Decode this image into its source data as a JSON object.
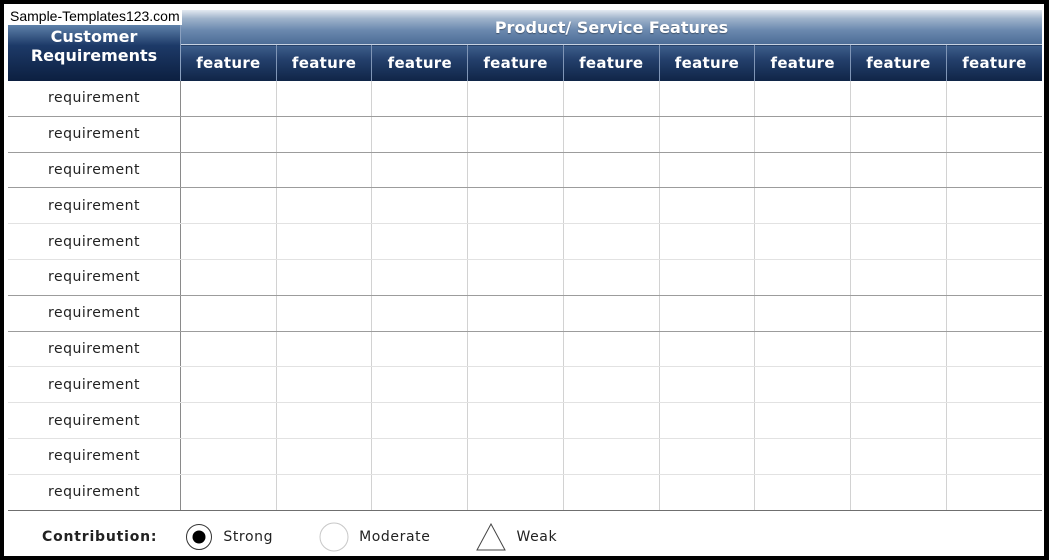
{
  "watermark": "Sample-Templates123.com",
  "header": {
    "corner_label_line1": "Customer",
    "corner_label_line2": "Requirements",
    "group_label": "Product/ Service Features",
    "features": [
      "feature",
      "feature",
      "feature",
      "feature",
      "feature",
      "feature",
      "feature",
      "feature",
      "feature"
    ]
  },
  "requirements": [
    "requirement",
    "requirement",
    "requirement",
    "requirement",
    "requirement",
    "requirement",
    "requirement",
    "requirement",
    "requirement",
    "requirement",
    "requirement",
    "requirement"
  ],
  "legend": {
    "title": "Contribution:",
    "items": [
      {
        "label": "Strong",
        "icon": "filled-circle-icon"
      },
      {
        "label": "Moderate",
        "icon": "open-circle-icon"
      },
      {
        "label": "Weak",
        "icon": "triangle-icon"
      }
    ]
  },
  "colors": {
    "header_dark": "#0f2446",
    "header_light": "#6a88ae"
  }
}
